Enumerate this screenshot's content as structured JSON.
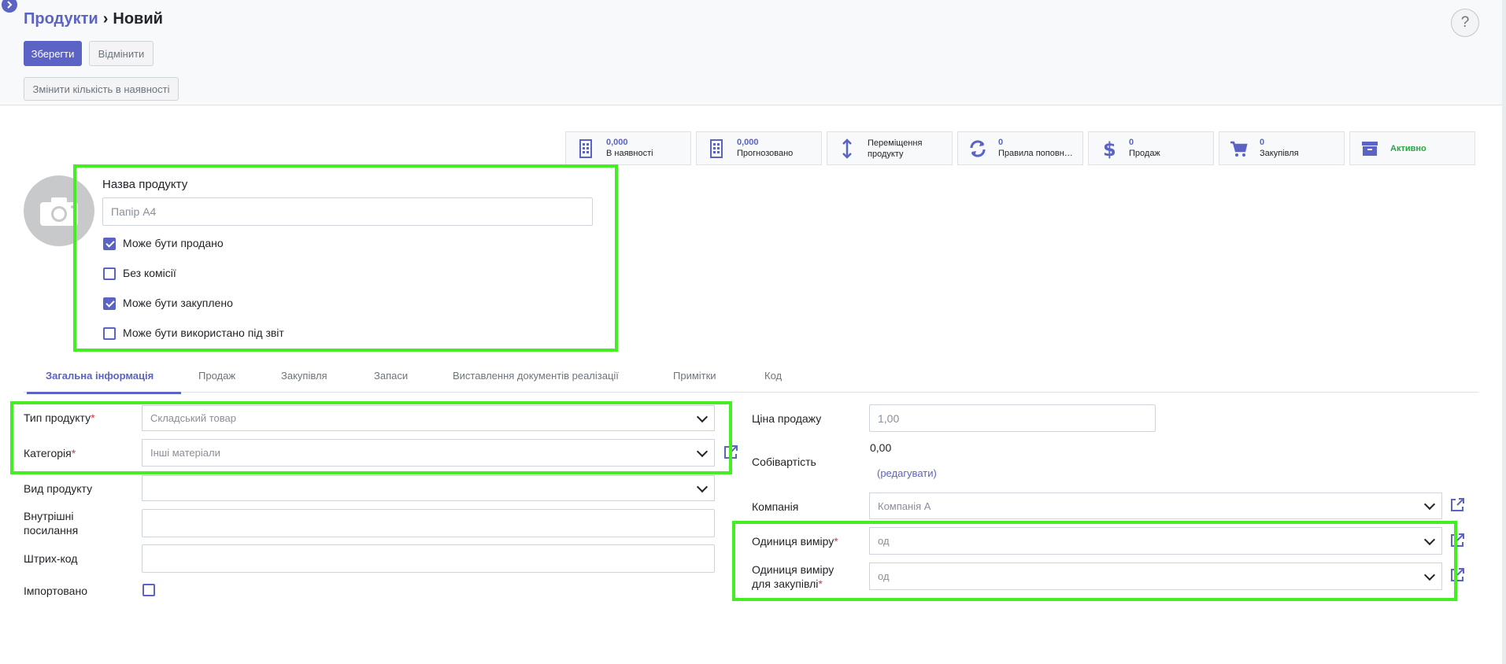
{
  "breadcrumb": {
    "parent": "Продукти",
    "separator": "›",
    "current": "Новий"
  },
  "toolbar": {
    "save_label": "Зберегти",
    "cancel_label": "Відмінити",
    "update_qty_label": "Змінити кількість в наявності",
    "help_label": "?"
  },
  "stats": {
    "on_hand": {
      "value": "0,000",
      "label": "В наявності"
    },
    "forecast": {
      "value": "0,000",
      "label": "Прогнозовано"
    },
    "moves": {
      "label_line1": "Переміщення",
      "label_line2": "продукту"
    },
    "reorder": {
      "value": "0",
      "label": "Правила поповн…"
    },
    "sales": {
      "value": "0",
      "label": "Продаж"
    },
    "purchases": {
      "value": "0",
      "label": "Закупівля"
    },
    "active": {
      "label": "Активно"
    }
  },
  "product": {
    "name_label": "Назва продукту",
    "name_placeholder": "Папір A4",
    "checkboxes": [
      {
        "label": "Може бути продано",
        "checked": true
      },
      {
        "label": "Без комісії",
        "checked": false
      },
      {
        "label": "Може бути закуплено",
        "checked": true
      },
      {
        "label": "Може бути використано під звіт",
        "checked": false
      }
    ]
  },
  "tabs": [
    "Загальна інформація",
    "Продаж",
    "Закупівля",
    "Запаси",
    "Виставлення документів реалізації",
    "Примітки",
    "Код"
  ],
  "general": {
    "type_label": "Тип продукту",
    "type_value": "Складський товар",
    "category_label": "Категорія",
    "category_value": "Інші матеріали",
    "kind_label": "Вид продукту",
    "kind_value": "",
    "internal_ref_label_1": "Внутрішні",
    "internal_ref_label_2": "посилання",
    "barcode_label": "Штрих-код",
    "imported_label": "Імпортовано",
    "req_mark": "*",
    "sale_price_label": "Ціна продажу",
    "sale_price_value": "1,00",
    "cost_label": "Собівартість",
    "cost_value": "0,00",
    "cost_edit": "(редагувати)",
    "company_label": "Компанія",
    "company_value": "Компанія А",
    "uom_label": "Одиниця виміру",
    "uom_value": "од",
    "po_uom_label_1": "Одиниця виміру",
    "po_uom_label_2": "для закупівлі",
    "po_uom_value": "од"
  },
  "colors": {
    "accent": "#5b63c4",
    "highlight": "#44ee22",
    "active": "#28a745",
    "required": "#dc3545"
  }
}
